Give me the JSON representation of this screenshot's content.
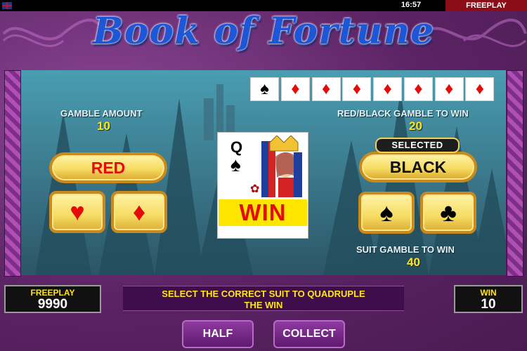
{
  "top_bar": {
    "clock": "16:57",
    "mode": "FREEPLAY",
    "flag_icon": "uk-flag-icon"
  },
  "logo": {
    "text": "Book of Fortune"
  },
  "history": {
    "cards": [
      {
        "suit": "spades",
        "glyph": "♠",
        "color": "#000000"
      },
      {
        "suit": "diamonds",
        "glyph": "♦",
        "color": "#e50b0b"
      },
      {
        "suit": "diamonds",
        "glyph": "♦",
        "color": "#e50b0b"
      },
      {
        "suit": "diamonds",
        "glyph": "♦",
        "color": "#e50b0b"
      },
      {
        "suit": "diamonds",
        "glyph": "♦",
        "color": "#e50b0b"
      },
      {
        "suit": "diamonds",
        "glyph": "♦",
        "color": "#e50b0b"
      },
      {
        "suit": "diamonds",
        "glyph": "♦",
        "color": "#e50b0b"
      },
      {
        "suit": "diamonds",
        "glyph": "♦",
        "color": "#e50b0b"
      }
    ]
  },
  "gamble_amount": {
    "label": "GAMBLE AMOUNT",
    "value": "10"
  },
  "color_gamble": {
    "label": "RED/BLACK GAMBLE TO WIN",
    "value": "20"
  },
  "suit_gamble": {
    "label": "SUIT GAMBLE TO WIN",
    "value": "40"
  },
  "buttons": {
    "red": "RED",
    "black": "BLACK",
    "selected_tag": "SELECTED",
    "hearts_glyph": "♥",
    "diamonds_glyph": "♦",
    "spades_glyph": "♠",
    "clubs_glyph": "♣",
    "half": "HALF",
    "collect": "COLLECT"
  },
  "card": {
    "rank": "Q",
    "suit_glyph": "♠",
    "result": "WIN"
  },
  "freeplay": {
    "label": "FREEPLAY",
    "value": "9990"
  },
  "win": {
    "label": "WIN",
    "value": "10"
  },
  "message": {
    "line1": "SELECT THE CORRECT SUIT TO QUADRUPLE",
    "line2": "THE WIN"
  },
  "colors": {
    "gold": "#ffe51a",
    "red": "#e50b0b",
    "frame": "#6a2f72"
  }
}
